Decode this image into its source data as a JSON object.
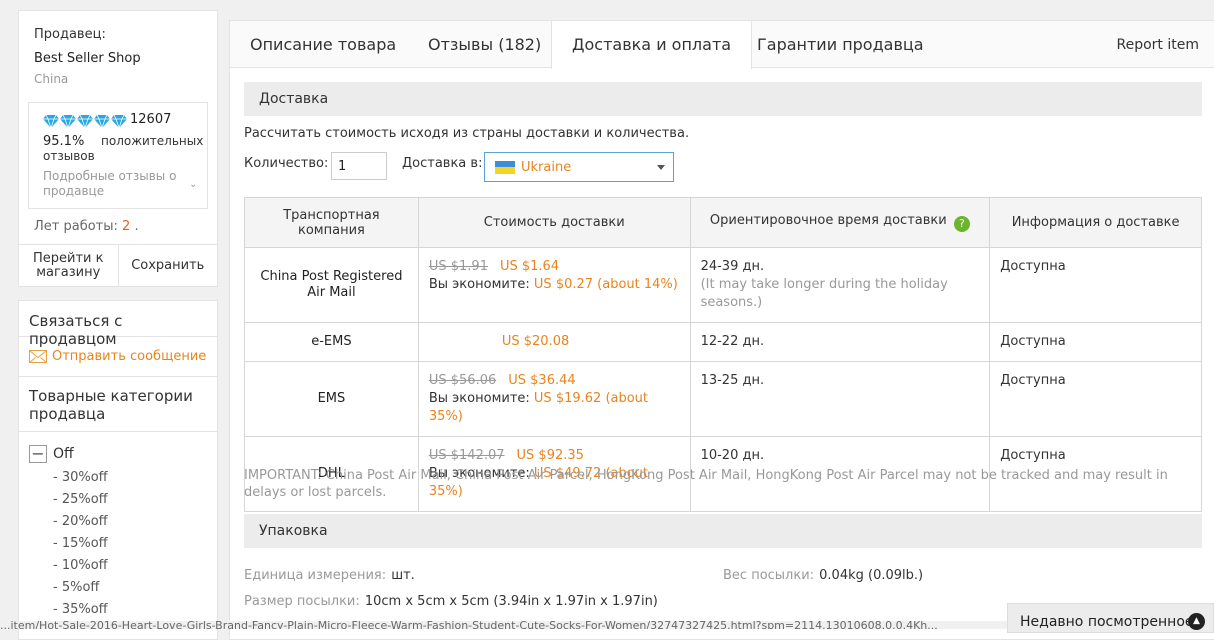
{
  "seller": {
    "label": "Продавец:",
    "shop_name": "Best Seller Shop",
    "country": "China",
    "score": "12607",
    "positive_pct": "95.1%",
    "positive_txt": "положительных отзывов",
    "details_link": "Подробные отзывы о продавце",
    "years_label": "Лет работы:",
    "years_value": "2",
    "years_suffix": ".",
    "go_to_store": "Перейти к магазину",
    "save": "Сохранить"
  },
  "contact": {
    "title": "Связаться с продавцом",
    "send_message": "Отправить сообщение"
  },
  "categories": {
    "title": "Товарные категории продавца",
    "group": "Off",
    "items": [
      "- 30%off",
      "- 25%off",
      "- 20%off",
      "- 15%off",
      "- 10%off",
      "- 5%off",
      "- 35%off"
    ]
  },
  "tabs": {
    "description": "Описание товара",
    "reviews": "Отзывы (182)",
    "shipping": "Доставка и оплата",
    "guarantees": "Гарантии продавца",
    "report": "Report item"
  },
  "shipping": {
    "section_title": "Доставка",
    "calc_text": "Рассчитать стоимость исходя из страны доставки и количества.",
    "qty_label": "Количество:",
    "qty_value": "1",
    "ship_to_label": "Доставка в:",
    "country": "Ukraine",
    "headers": {
      "company": "Транспортная компания",
      "cost": "Стоимость доставки",
      "time": "Ориентировочное время доставки",
      "help": "?",
      "info": "Информация о доставке"
    },
    "rows": [
      {
        "company": "China Post Registered Air Mail",
        "old_price": "US $1.91",
        "price": "US $1.64",
        "save_label": "Вы экономите:",
        "save_value": "US $0.27 (about 14%)",
        "time": "24-39 дн.",
        "time_note": "(It may take longer during the holiday seasons.)",
        "info": "Доступна"
      },
      {
        "company": "e-EMS",
        "price": "US $20.08",
        "time": "12-22 дн.",
        "info": "Доступна"
      },
      {
        "company": "EMS",
        "old_price": "US $56.06",
        "price": "US $36.44",
        "save_label": "Вы экономите:",
        "save_value": "US $19.62 (about 35%)",
        "time": "13-25 дн.",
        "info": "Доступна"
      },
      {
        "company": "DHL",
        "old_price": "US $142.07",
        "price": "US $92.35",
        "save_label": "Вы экономите:",
        "save_value": "US $49.72 (about 35%)",
        "time": "10-20 дн.",
        "info": "Доступна"
      }
    ],
    "important": "IMPORTANT: China Post Air Mail, China Post Air Parcel, HongKong Post Air Mail, HongKong Post Air Parcel may not be tracked and may result in delays or lost parcels."
  },
  "packaging": {
    "section_title": "Упаковка",
    "unit_label": "Единица измерения:",
    "unit_value": "шт.",
    "weight_label": "Вес посылки:",
    "weight_value": "0.04kg (0.09lb.)",
    "size_label": "Размер посылки:",
    "size_value": "10cm x 5cm x 5cm (3.94in x 1.97in x 1.97in)"
  },
  "recent": {
    "label": "Недавно посмотренное"
  },
  "status_bar": {
    "url": "...item/Hot-Sale-2016-Heart-Love-Girls-Brand-Fancy-Plain-Micro-Fleece-Warm-Fashion-Student-Cute-Socks-For-Women/32747327425.html?spm=2114.13010608.0.0.4Kh..."
  },
  "colors": {
    "accent": "#e8841e",
    "link_blue": "#5ba3d6",
    "diamond": "#29a7e1",
    "help_green": "#6ab42e"
  }
}
